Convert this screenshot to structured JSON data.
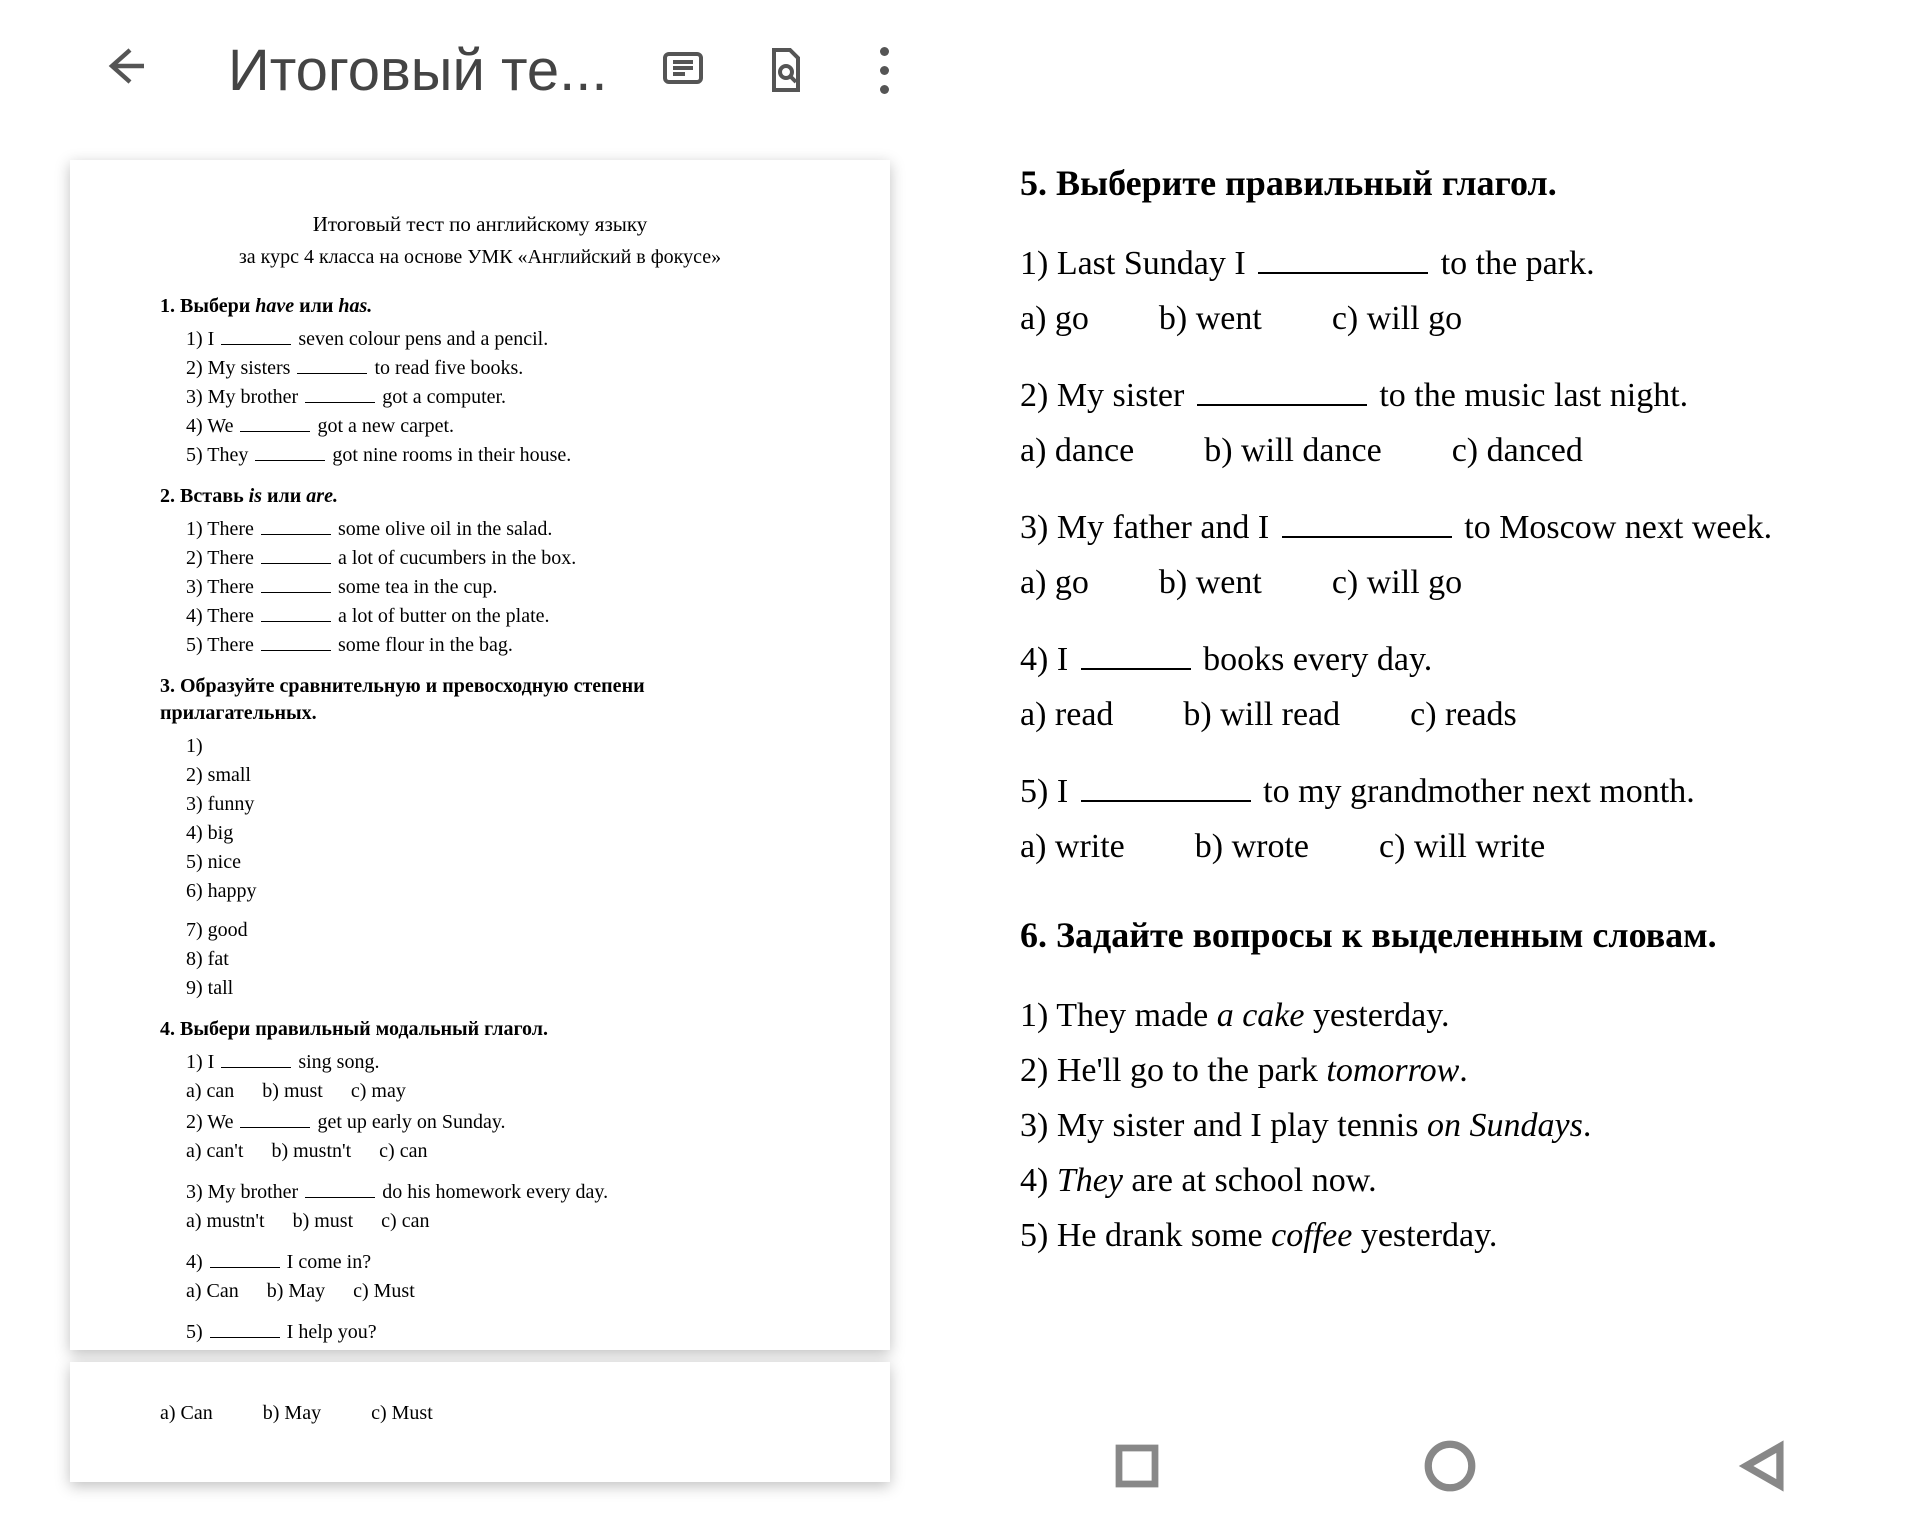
{
  "toolbar": {
    "title": "Итоговый те..."
  },
  "left_doc": {
    "title1": "Итоговый тест по английскому языку",
    "title2": "за курс 4 класса на основе УМК «Английский в фокусе»",
    "s1": {
      "head_pre": "1. Выбери ",
      "head_w1": "have",
      "head_mid": " или ",
      "head_w2": "has.",
      "items": [
        "1)  I ____ seven colour pens and a pencil.",
        "2)  My sisters ____ to read  five books.",
        "3)  My brother ____ got a computer.",
        "4)  We ____ got a new carpet.",
        "5)  They ____ got nine rooms in their house."
      ]
    },
    "s2": {
      "head_pre": "2. Вставь ",
      "head_w1": "is",
      "head_mid": " или ",
      "head_w2": "are.",
      "items": [
        "1)  There ____ some olive oil in the salad.",
        "2)  There ____ a lot of cucumbers in the box.",
        "3)  There ____ some tea in the cup.",
        "4)  There ____ a lot of butter on the plate.",
        "5)  There ____ some flour in the bag."
      ]
    },
    "s3": {
      "head": "3. Образуйте сравнительную и превосходную степени прилагательных.",
      "items_a": [
        "1)",
        "2)  small",
        "3)  funny",
        "4)  big",
        "5)  nice",
        "6)  happy"
      ],
      "items_b": [
        "7)  good",
        "8)  fat",
        "9)  tall"
      ]
    },
    "s4": {
      "head": "4. Выбери правильный модальный глагол.",
      "q1": "1)  I ____ sing song.",
      "o1": {
        "a": "a) can",
        "b": "b) must",
        "c": "c) may"
      },
      "q2": "2) We ____ get up early on Sunday.",
      "o2": {
        "a": "a) can't",
        "b": "b) mustn't",
        "c": "c) can"
      },
      "q3": "3) My brother ____ do his homework every day.",
      "o3": {
        "a": "a) mustn't",
        "b": "b) must",
        "c": "c) can"
      },
      "q4": "4) ____ I come in?",
      "o4": {
        "a": "a) Can",
        "b": "b) May",
        "c": "c) Must"
      },
      "q5": "5) ____ I help you?"
    },
    "page2_opts": {
      "a": "a) Can",
      "b": "b) May",
      "c": "c) Must"
    }
  },
  "right": {
    "s5": {
      "head": "5. Выберите правильный глагол.",
      "q1_a": "1)  Last Sunday I ",
      "q1_b": " to the park.",
      "o1": {
        "a": "a) go",
        "b": "b) went",
        "c": "c) will go"
      },
      "q2_a": "2)  My sister ",
      "q2_b": " to the music last night.",
      "o2": {
        "a": "a) dance",
        "b": "b) will dance",
        "c": "c) danced"
      },
      "q3_a": "3)  My father and I ",
      "q3_b": " to Moscow next week.",
      "o3": {
        "a": "a) go",
        "b": "b) went",
        "c": "c) will go"
      },
      "q4_a": "4)  I ",
      "q4_b": " books every day.",
      "o4": {
        "a": "a) read",
        "b": "b) will read",
        "c": "c) reads"
      },
      "q5_a": "5)  I ",
      "q5_b": " to my grandmother next month.",
      "o5": {
        "a": "a) write",
        "b": "b) wrote",
        "c": "c) will write"
      }
    },
    "s6": {
      "head": "6. Задайте вопросы к выделенным словам.",
      "q1_a": "1)  They made ",
      "q1_i": "a cake",
      "q1_b": " yesterday.",
      "q2_a": "2)  He'll go to the park ",
      "q2_i": "tomorrow",
      "q2_b": ".",
      "q3_a": "3)  My sister and I play tennis ",
      "q3_i": "on Sundays",
      "q3_b": ".",
      "q4_a": "4)  ",
      "q4_i": "They",
      "q4_b": " are at school now.",
      "q5_a": "5)  He drank some ",
      "q5_i": "coffee",
      "q5_b": " yesterday."
    }
  }
}
